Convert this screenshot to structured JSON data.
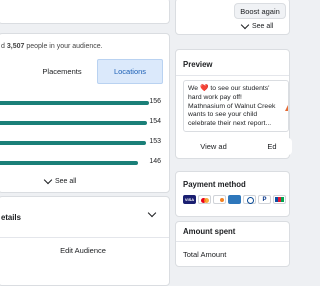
{
  "left_panel": {
    "audience_text_prefix": "d",
    "audience_count": "3,507",
    "audience_text_suffix": "people in your audience.",
    "tabs": [
      {
        "label": "Placements",
        "active": false
      },
      {
        "label": "Locations",
        "active": true
      }
    ],
    "bars": [
      {
        "value": 156,
        "label": "156"
      },
      {
        "value": 154,
        "label": "154"
      },
      {
        "value": 153,
        "label": "153"
      },
      {
        "value": 146,
        "label": "146"
      }
    ],
    "see_all_label": "See all",
    "details_title": "etails",
    "edit_audience_label": "Edit Audience"
  },
  "right_panel": {
    "boost_again_label": "Boost again",
    "see_all_label": "See all",
    "preview_title": "Preview",
    "preview_text_before_heart": "We",
    "preview_text_after_heart": "to see our students' hard work pay off! Mathnasium of Walnut Creek wants to see your child celebrate their next report...",
    "view_ad_label": "View ad",
    "edit_label_partial": "Ed",
    "payment_method_title": "Payment method",
    "payment_icons": [
      "visa-icon",
      "mastercard-icon",
      "discover-icon",
      "amex-icon",
      "diners-icon",
      "paypal-icon",
      "jcb-icon"
    ],
    "payment_labels": {
      "visa": "VISA"
    },
    "amount_spent_title": "Amount spent",
    "total_amount_label": "Total Amount"
  },
  "colors": {
    "bar": "#1a7f78",
    "active_tab_bg": "#dbe9fb",
    "active_tab_text": "#1b5fb5",
    "heart": "#e0245e"
  }
}
